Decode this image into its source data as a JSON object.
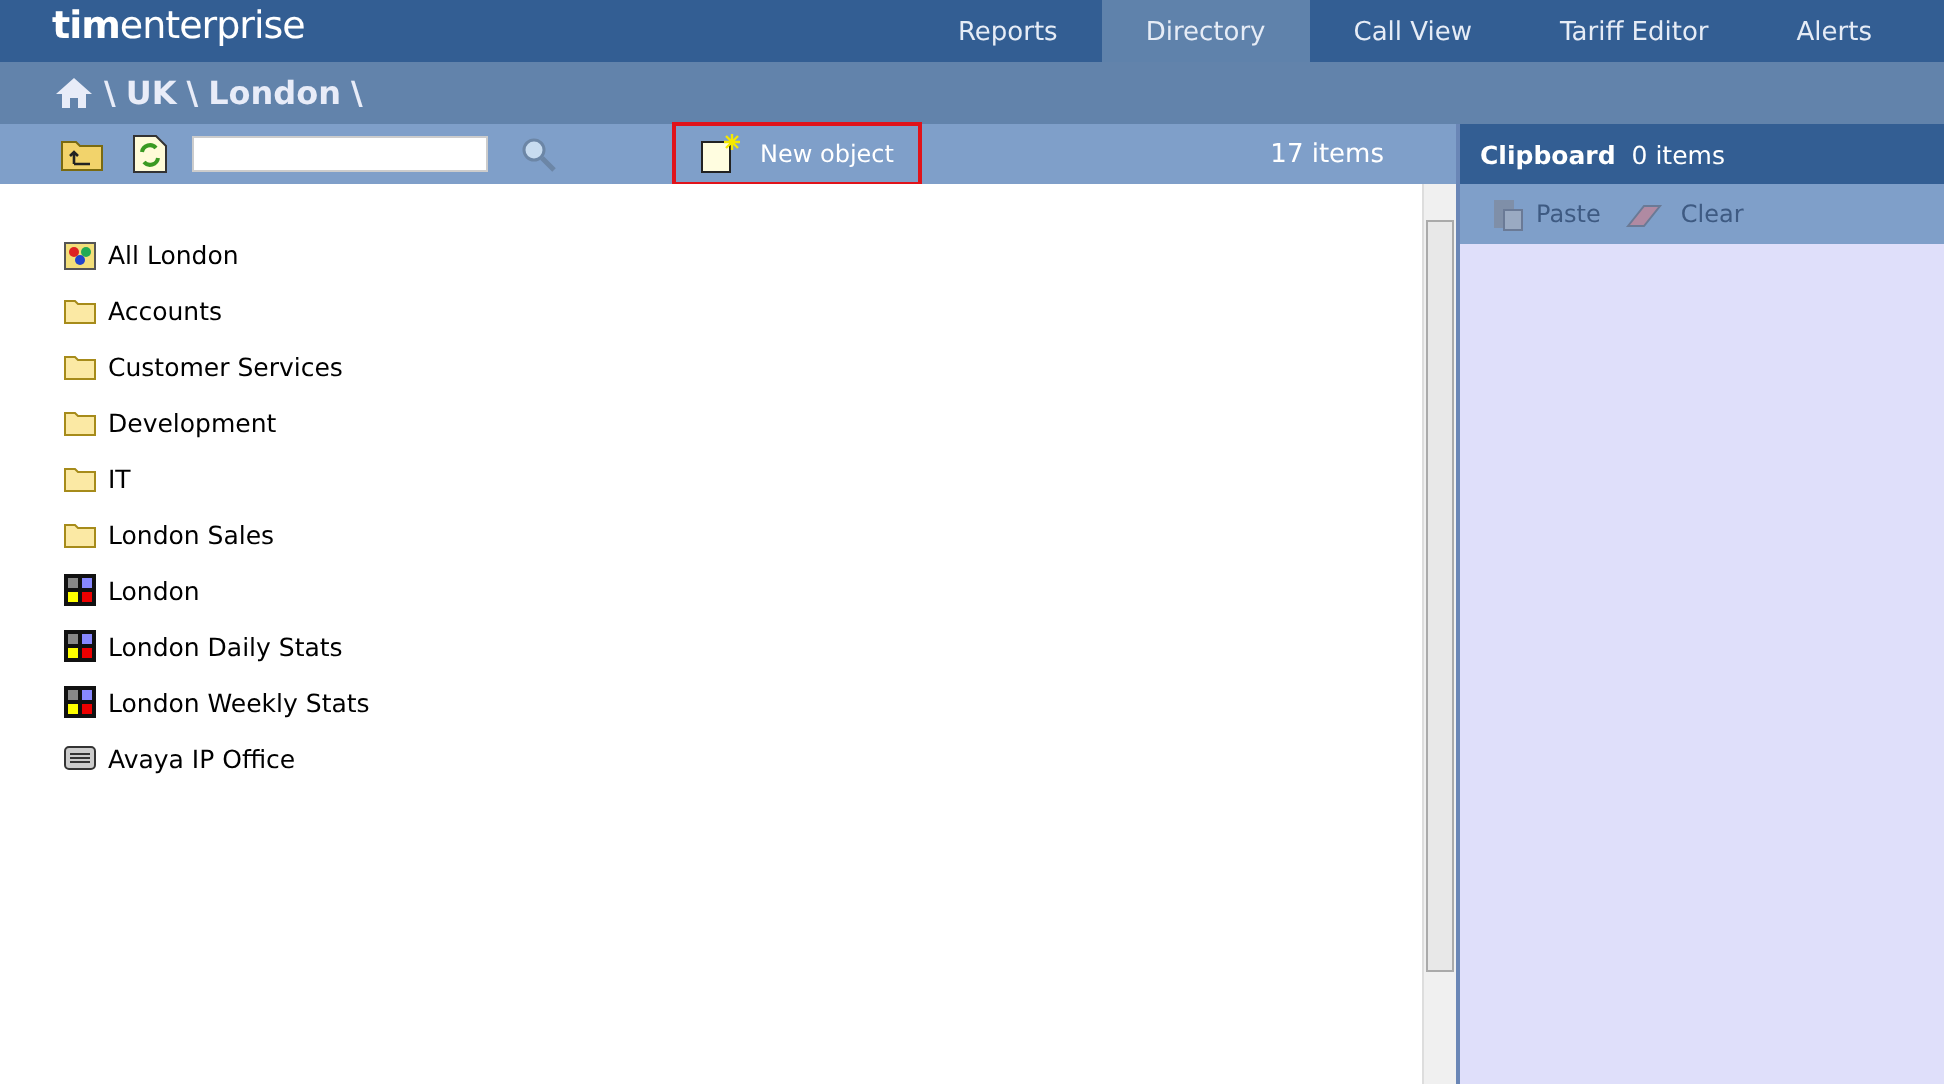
{
  "logo": "**tim**enterprise",
  "tabs": [
    {
      "label": "Reports",
      "selected": false
    },
    {
      "label": "Directory",
      "selected": true
    },
    {
      "label": "Call View",
      "selected": false
    },
    {
      "label": "Tariff Editor",
      "selected": false
    },
    {
      "label": "Alerts",
      "selected": false
    }
  ],
  "breadcrumb": {
    "separator": "\\",
    "items": [
      "UK",
      "London"
    ]
  },
  "toolbar": {
    "new_object": {
      "label": "New object",
      "highlighted": true
    },
    "count": "17 items"
  },
  "items": [
    {
      "kind": "group",
      "label": "All London"
    },
    {
      "kind": "folder",
      "label": "Accounts"
    },
    {
      "kind": "folder",
      "label": "Customer Services"
    },
    {
      "kind": "folder",
      "label": "Development"
    },
    {
      "kind": "folder",
      "label": "IT"
    },
    {
      "kind": "folder",
      "label": "London Sales"
    },
    {
      "kind": "report",
      "label": "London"
    },
    {
      "kind": "report",
      "label": "London Daily Stats"
    },
    {
      "kind": "report",
      "label": "London Weekly Stats"
    },
    {
      "kind": "device",
      "label": "Avaya IP Office"
    }
  ],
  "clipboard": {
    "title": "Clipboard",
    "count": "0 items",
    "actions": [
      {
        "kind": "paste",
        "label": "Paste",
        "disabled": true
      },
      {
        "kind": "clear",
        "label": "Clear",
        "disabled": true
      }
    ]
  }
}
